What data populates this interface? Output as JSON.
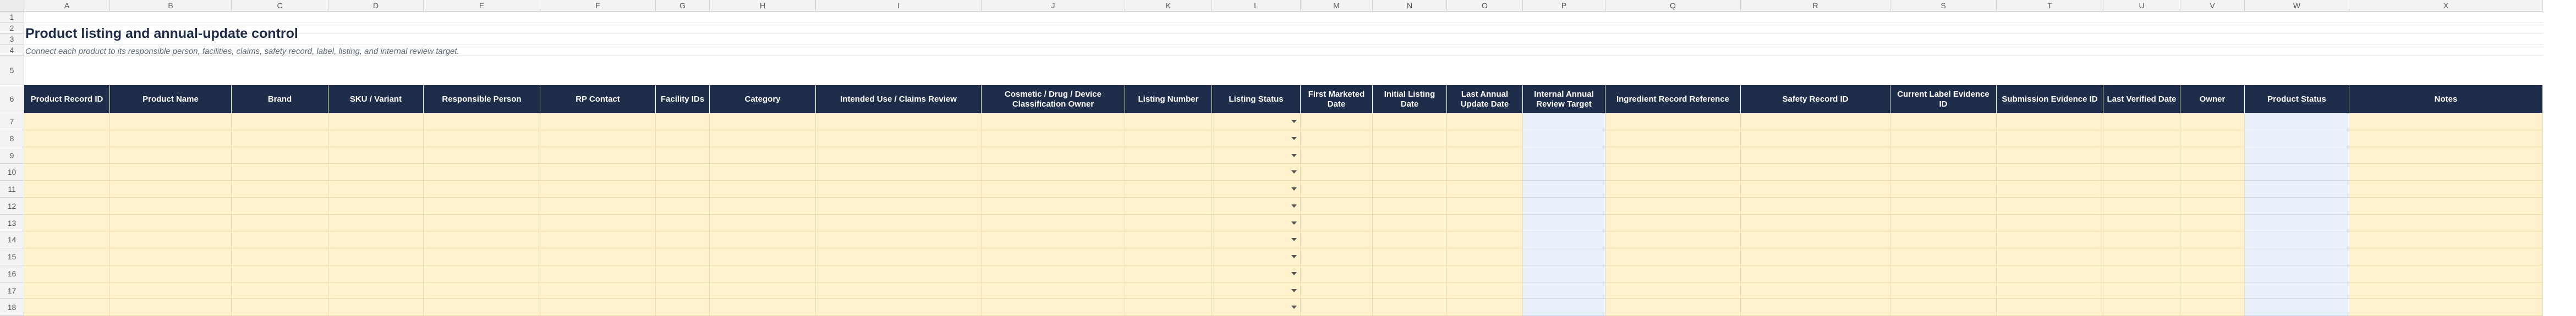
{
  "columns": [
    "A",
    "B",
    "C",
    "D",
    "E",
    "F",
    "G",
    "H",
    "I",
    "J",
    "K",
    "L",
    "M",
    "N",
    "O",
    "P",
    "Q",
    "R",
    "S",
    "T",
    "U",
    "V",
    "W",
    "X"
  ],
  "rows": [
    "1",
    "2",
    "3",
    "4",
    "5",
    "6",
    "7",
    "8",
    "9",
    "10",
    "11",
    "12",
    "13",
    "14",
    "15",
    "16",
    "17",
    "18"
  ],
  "sheet": {
    "title": "Product listing and annual-update control",
    "subtitle": "Connect each product to its responsible person, facilities, claims, safety record, label, listing, and internal review target."
  },
  "headers": [
    "Product Record ID",
    "Product Name",
    "Brand",
    "SKU / Variant",
    "Responsible Person",
    "RP Contact",
    "Facility IDs",
    "Category",
    "Intended Use / Claims Review",
    "Cosmetic / Drug / Device Classification Owner",
    "Listing Number",
    "Listing Status",
    "First Marketed Date",
    "Initial Listing Date",
    "Last Annual Update Date",
    "Internal Annual Review Target",
    "Ingredient Record Reference",
    "Safety Record ID",
    "Current Label Evidence ID",
    "Submission Evidence ID",
    "Last Verified Date",
    "Owner",
    "Product Status",
    "Notes"
  ],
  "icons": {
    "dropdown": "chevron-down-icon"
  },
  "colors": {
    "header_bg": "#1d2d4a",
    "input_fill": "#fff2cc",
    "formula_fill": "#e8f0fa",
    "title_color": "#1b2b48"
  }
}
